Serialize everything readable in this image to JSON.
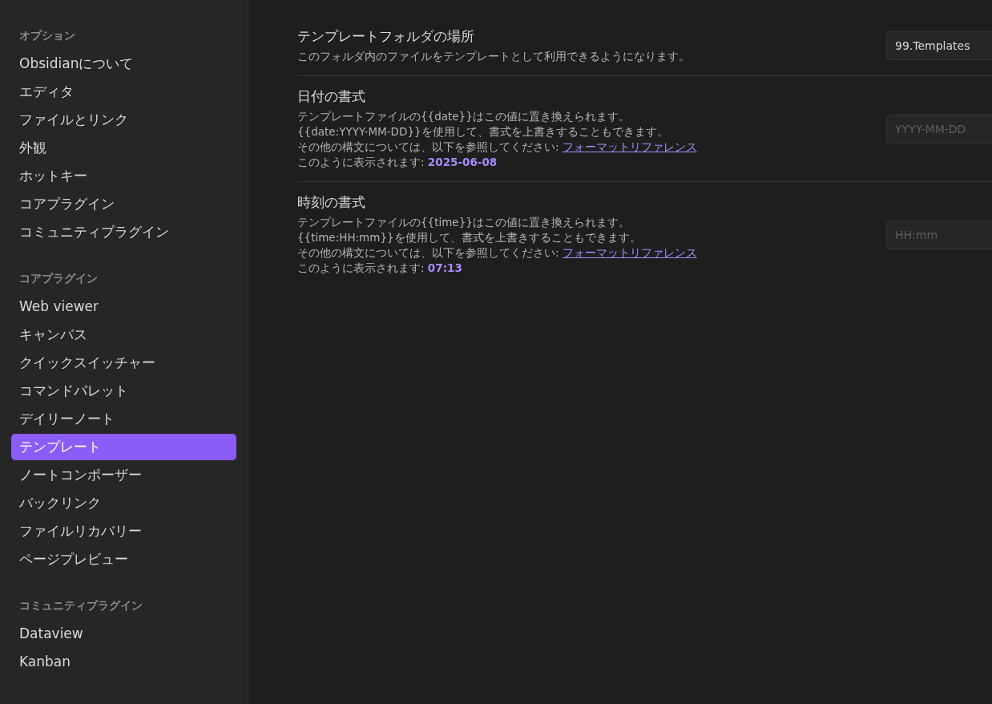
{
  "sidebar": {
    "sections": [
      {
        "heading": "オプション",
        "items": [
          {
            "label": "Obsidianについて",
            "selected": false
          },
          {
            "label": "エディタ",
            "selected": false
          },
          {
            "label": "ファイルとリンク",
            "selected": false
          },
          {
            "label": "外観",
            "selected": false
          },
          {
            "label": "ホットキー",
            "selected": false
          },
          {
            "label": "コアプラグイン",
            "selected": false
          },
          {
            "label": "コミュニティプラグイン",
            "selected": false
          }
        ]
      },
      {
        "heading": "コアプラグイン",
        "items": [
          {
            "label": "Web viewer",
            "selected": false
          },
          {
            "label": "キャンバス",
            "selected": false
          },
          {
            "label": "クイックスイッチャー",
            "selected": false
          },
          {
            "label": "コマンドパレット",
            "selected": false
          },
          {
            "label": "デイリーノート",
            "selected": false
          },
          {
            "label": "テンプレート",
            "selected": true
          },
          {
            "label": "ノートコンポーザー",
            "selected": false
          },
          {
            "label": "バックリンク",
            "selected": false
          },
          {
            "label": "ファイルリカバリー",
            "selected": false
          },
          {
            "label": "ページプレビュー",
            "selected": false
          }
        ]
      },
      {
        "heading": "コミュニティプラグイン",
        "items": [
          {
            "label": "Dataview",
            "selected": false
          },
          {
            "label": "Kanban",
            "selected": false
          }
        ]
      }
    ]
  },
  "settings": [
    {
      "name": "テンプレートフォルダの場所",
      "description": [
        "このフォルダ内のファイルをテンプレートとして利用できるようになります。"
      ],
      "field": {
        "value": "99.Templates"
      }
    },
    {
      "name": "日付の書式",
      "description": [
        "テンプレートファイルの{{date}}はこの値に置き換えられます。",
        "{{date:YYYY-MM-DD}}を使用して、書式を上書きすることもできます。"
      ],
      "reference": {
        "text": "その他の構文については、以下を参照してください:",
        "link": "フォーマットリファレンス"
      },
      "preview": {
        "text": "このように表示されます:",
        "value": "2025-06-08"
      },
      "field": {
        "placeholder": "YYYY-MM-DD"
      }
    },
    {
      "name": "時刻の書式",
      "description": [
        "テンプレートファイルの{{time}}はこの値に置き換えられます。",
        "{{time:HH:mm}}を使用して、書式を上書きすることもできます。"
      ],
      "reference": {
        "text": "その他の構文については、以下を参照してください:",
        "link": "フォーマットリファレンス"
      },
      "preview": {
        "text": "このように表示されます:",
        "value": "07:13"
      },
      "field": {
        "placeholder": "HH:mm"
      }
    }
  ]
}
